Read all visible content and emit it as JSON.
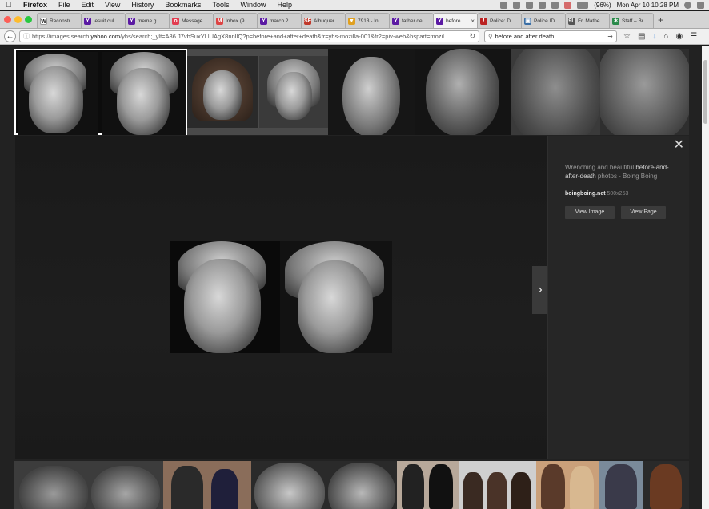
{
  "menubar": {
    "apple": "",
    "items": [
      "Firefox",
      "File",
      "Edit",
      "View",
      "History",
      "Bookmarks",
      "Tools",
      "Window",
      "Help"
    ],
    "battery": "(96%)",
    "clock": "Mon Apr 10  10:28 PM"
  },
  "tabs": [
    {
      "label": "Reconstr",
      "fav": "W",
      "color": "#fff"
    },
    {
      "label": "jesuit cul",
      "fav": "Y",
      "color": "#5b1aa3"
    },
    {
      "label": "meme g",
      "fav": "Y",
      "color": "#5b1aa3"
    },
    {
      "label": "Message",
      "fav": "o",
      "color": "#e23c50"
    },
    {
      "label": "Inbox (9",
      "fav": "M",
      "color": "#d44"
    },
    {
      "label": "march 2",
      "fav": "Y",
      "color": "#5b1aa3"
    },
    {
      "label": "Albuquer",
      "fav": "SF",
      "color": "#c0392b"
    },
    {
      "label": "7913 - In",
      "fav": "▼",
      "color": "#e0a020"
    },
    {
      "label": "father de",
      "fav": "Y",
      "color": "#5b1aa3"
    },
    {
      "label": "before",
      "fav": "Y",
      "color": "#5b1aa3",
      "active": true
    },
    {
      "label": "Police: D",
      "fav": "!",
      "color": "#b22"
    },
    {
      "label": "Police ID",
      "fav": "▣",
      "color": "#3a6ea5"
    },
    {
      "label": "Fr. Mathe",
      "fav": "9L",
      "color": "#555"
    },
    {
      "label": "Staff – Br",
      "fav": "✶",
      "color": "#2a8a4a"
    }
  ],
  "nav": {
    "url_prefix": "https://images.search.",
    "url_domain": "yahoo.com",
    "url_rest": "/yhs/search;_ylt=A86.J7vbSuxYLlUAgX8nnIlQ?p=before+and+after+death&fr=yhs-mozilla-001&fr2=piv-web&hspart=mozil",
    "search_value": "before and after death"
  },
  "viewer": {
    "title_pre": "Wrenching and beautiful ",
    "title_bold": "before-and-after-death",
    "title_post": " photos - Boing Boing",
    "source": "boingboing.net",
    "dims": "500x253",
    "view_image": "View Image",
    "view_page": "View Page",
    "close": "✕",
    "next": "›"
  }
}
